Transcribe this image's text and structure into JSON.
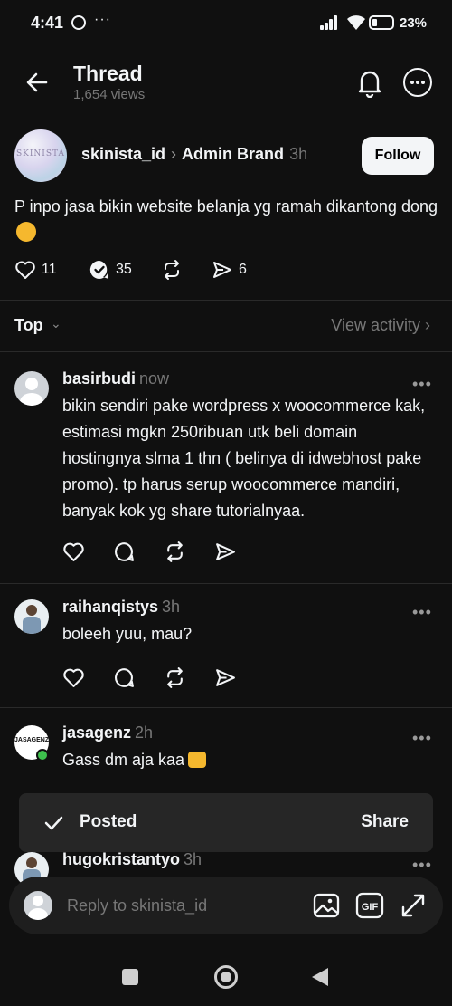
{
  "status_bar": {
    "time": "4:41",
    "dots": "···",
    "battery": "23%"
  },
  "header": {
    "title": "Thread",
    "views": "1,654 views",
    "back_icon": "arrow-left-icon",
    "bell_icon": "bell-icon",
    "more_icon": "more-circle-icon"
  },
  "post": {
    "avatar_text": "SKINISTA",
    "username": "skinista_id",
    "chevron": "›",
    "brand": "Admin Brand",
    "time": "3h",
    "follow_label": "Follow",
    "text": "P inpo jasa bikin website belanja yg ramah dikantong dong",
    "likes": "11",
    "replies": "35",
    "shares": "6"
  },
  "sort": {
    "label": "Top",
    "chevron": "⌄",
    "view_activity": "View activity ›"
  },
  "replies": [
    {
      "username": "basirbudi",
      "time": "now",
      "text": "bikin sendiri pake wordpress x woocommerce kak, estimasi mgkn 250ribuan utk beli domain hostingnya slma 1 thn ( belinya di idwebhost pake promo). tp harus serup woocommerce mandiri, banyak kok yg share tutorialnyaa.",
      "more": "•••"
    },
    {
      "username": "raihanqistys",
      "time": "3h",
      "text": "boleeh yuu, mau?",
      "more": "•••"
    },
    {
      "username": "jasagenz",
      "time": "2h",
      "text": "Gass dm aja kaa",
      "avatar_text": "JASAGENZ",
      "more": "•••"
    },
    {
      "username": "hugokristantyo",
      "time": "3h",
      "text": "",
      "more": "•••"
    }
  ],
  "toast": {
    "label": "Posted",
    "action": "Share"
  },
  "composer": {
    "placeholder": "Reply to skinista_id",
    "gif_label": "GIF"
  },
  "colors": {
    "background": "#101010",
    "text": "#f3f5f7",
    "muted": "#777777",
    "toast": "#262626",
    "online": "#3ec14d"
  }
}
